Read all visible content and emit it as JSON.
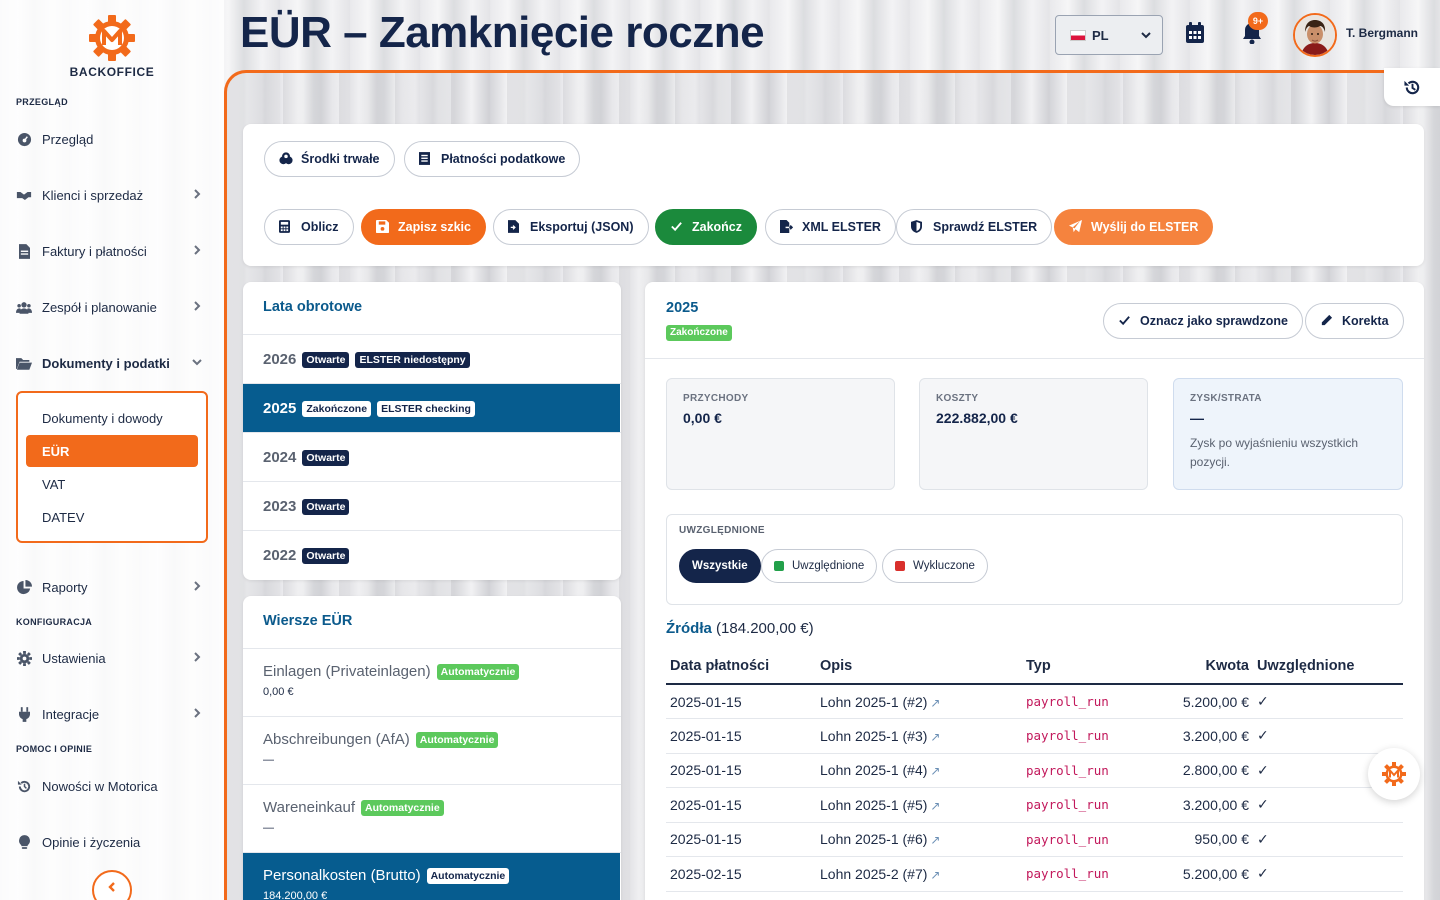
{
  "brand": {
    "name": "BACKOFFICE",
    "accent": "#f26a1b",
    "primary": "#14254a",
    "selected_row": "#065c8f"
  },
  "sidebar": {
    "sections": {
      "overview": "PRZEGLĄD",
      "config": "KONFIGURACJA",
      "help": "POMOC I OPINIE"
    },
    "items": [
      {
        "label": "Przegląd",
        "icon": "dashboard-icon"
      },
      {
        "label": "Klienci i sprzedaż",
        "icon": "handshake-icon"
      },
      {
        "label": "Faktury i płatności",
        "icon": "invoice-icon"
      },
      {
        "label": "Zespół i planowanie",
        "icon": "users-icon"
      },
      {
        "label": "Dokumenty i podatki",
        "icon": "folder-open-icon"
      },
      {
        "label": "Raporty",
        "icon": "pie-chart-icon"
      },
      {
        "label": "Ustawienia",
        "icon": "gear-icon"
      },
      {
        "label": "Integracje",
        "icon": "plug-icon"
      },
      {
        "label": "Nowości w Motorica",
        "icon": "history-icon"
      },
      {
        "label": "Opinie i życzenia",
        "icon": "lightbulb-icon"
      }
    ],
    "submenu": [
      {
        "label": "Dokumenty i dowody"
      },
      {
        "label": "EÜR",
        "active": true
      },
      {
        "label": "VAT"
      },
      {
        "label": "DATEV"
      }
    ]
  },
  "header": {
    "title": "EÜR – Zamknięcie roczne",
    "language": "PL",
    "notifications_badge": "9+",
    "user_name": "T. Bergmann"
  },
  "toolbar": {
    "row1": [
      {
        "label": "Środki trwałe",
        "icon": "coins-icon"
      },
      {
        "label": "Płatności podatkowe",
        "icon": "receipt-icon"
      }
    ],
    "row2": [
      {
        "label": "Oblicz",
        "icon": "calculator-icon"
      },
      {
        "label": "Zapisz szkic",
        "icon": "save-icon"
      },
      {
        "label": "Eksportuj (JSON)",
        "icon": "file-export-icon"
      },
      {
        "label": "Zakończ",
        "icon": "check-icon"
      },
      {
        "label": "XML ELSTER",
        "icon": "file-arrow-icon"
      },
      {
        "label": "Sprawdź ELSTER",
        "icon": "shield-icon"
      },
      {
        "label": "Wyślij do ELSTER",
        "icon": "send-icon"
      }
    ]
  },
  "years_panel": {
    "title": "Lata obrotowe",
    "years": [
      {
        "year": "2026",
        "tags": [
          "Otwarte",
          "ELSTER niedostępny"
        ]
      },
      {
        "year": "2025",
        "tags": [
          "Zakończone",
          "ELSTER checking"
        ],
        "selected": true
      },
      {
        "year": "2024",
        "tags": [
          "Otwarte"
        ]
      },
      {
        "year": "2023",
        "tags": [
          "Otwarte"
        ]
      },
      {
        "year": "2022",
        "tags": [
          "Otwarte"
        ]
      }
    ]
  },
  "eur_rows_panel": {
    "title": "Wiersze EÜR",
    "rows": [
      {
        "label": "Einlagen (Privateinlagen)",
        "tag": "Automatycznie",
        "value": "0,00 €"
      },
      {
        "label": "Abschreibungen (AfA)",
        "tag": "Automatycznie",
        "value": "—"
      },
      {
        "label": "Wareneinkauf",
        "tag": "Automatycznie",
        "value": "—"
      },
      {
        "label": "Personalkosten (Brutto)",
        "tag": "Automatycznie",
        "value": "184.200,00 €",
        "selected": true
      }
    ]
  },
  "detail": {
    "year": "2025",
    "status": "Zakończone",
    "mark_checked_label": "Oznacz jako sprawdzone",
    "correction_label": "Korekta",
    "stats": [
      {
        "title": "PRZYCHODY",
        "value": "0,00 €",
        "desc": ""
      },
      {
        "title": "KOSZTY",
        "value": "222.882,00 €",
        "desc": ""
      },
      {
        "title": "ZYSK/STRATA",
        "value": "—",
        "desc": "Zysk po wyjaśnieniu wszystkich pozycji."
      }
    ],
    "filter": {
      "title": "UWZGLĘDNIONE",
      "options": [
        {
          "label": "Wszystkie",
          "active": true
        },
        {
          "label": "Uwzględnione",
          "color": "#22a04a"
        },
        {
          "label": "Wykluczone",
          "color": "#d9302c"
        }
      ]
    },
    "sources": {
      "title": "Źródła",
      "total": "(184.200,00 €)",
      "columns": [
        "Data płatności",
        "Opis",
        "Typ",
        "Kwota",
        "Uwzględnione"
      ],
      "rows": [
        {
          "date": "2025-01-15",
          "desc": "Lohn 2025-1 (#2)",
          "type": "payroll_run",
          "amount": "5.200,00 €",
          "included": "✓"
        },
        {
          "date": "2025-01-15",
          "desc": "Lohn 2025-1 (#3)",
          "type": "payroll_run",
          "amount": "3.200,00 €",
          "included": "✓"
        },
        {
          "date": "2025-01-15",
          "desc": "Lohn 2025-1 (#4)",
          "type": "payroll_run",
          "amount": "2.800,00 €",
          "included": "✓"
        },
        {
          "date": "2025-01-15",
          "desc": "Lohn 2025-1 (#5)",
          "type": "payroll_run",
          "amount": "3.200,00 €",
          "included": "✓"
        },
        {
          "date": "2025-01-15",
          "desc": "Lohn 2025-1 (#6)",
          "type": "payroll_run",
          "amount": "950,00 €",
          "included": "✓"
        },
        {
          "date": "2025-02-15",
          "desc": "Lohn 2025-2 (#7)",
          "type": "payroll_run",
          "amount": "5.200,00 €",
          "included": "✓"
        }
      ]
    }
  }
}
